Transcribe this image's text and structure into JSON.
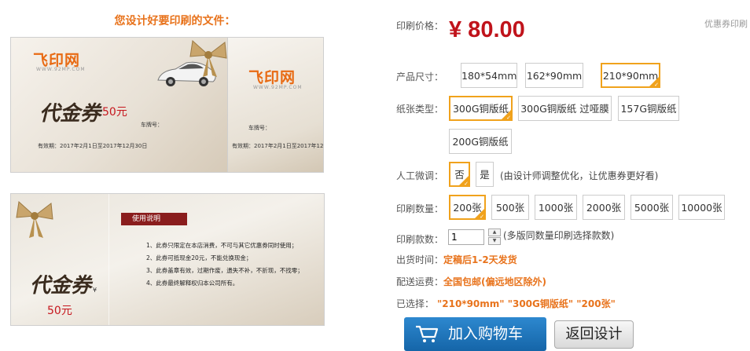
{
  "preview": {
    "title": "您设计好要印刷的文件：",
    "front": {
      "logo": "飞印网",
      "logo_sub": "WWW.92MP.COM",
      "voucher": "代金券",
      "amount": "50元",
      "plate_label": "车牌号：",
      "validity": "有效期：2017年2月1日至2017年12月30日"
    },
    "back_top": {
      "logo": "飞印网",
      "logo_sub": "WWW.92MP.COM",
      "plate_label": "车牌号：",
      "validity": "有效期：2017年2月1日至2017年12月30日"
    },
    "bottom": {
      "voucher": "代金券",
      "yen": "¥",
      "amount": "50元",
      "usage_title": "使用说明",
      "rules": [
        "1、此券只限定在本店消费，不可与其它优惠券同时使用；",
        "2、此券可抵现金20元，不能兑换现金；",
        "3、此券盖章有效，过期作废，遗失不补，不折现，不找零；",
        "4、此券最终解释权归本公司所有。"
      ]
    }
  },
  "product": {
    "price_label": "印刷价格：",
    "price": "¥ 80.00",
    "coupon": "优惠券印刷",
    "size_label": "产品尺寸：",
    "sizes": [
      "180*54mm",
      "162*90mm",
      "210*90mm"
    ],
    "paper_label": "纸张类型：",
    "papers": [
      "300G铜版纸",
      "300G铜版纸 过哑膜",
      "157G铜版纸",
      "200G铜版纸"
    ],
    "manual_label": "人工微调：",
    "manual_options": [
      "否",
      "是"
    ],
    "manual_hint": "(由设计师调整优化，让优惠券更好看)",
    "qty_label": "印刷数量：",
    "quantities": [
      "200张",
      "500张",
      "1000张",
      "2000张",
      "5000张",
      "10000张"
    ],
    "versions_label": "印刷款数：",
    "versions_value": "1",
    "versions_hint": "(多版同数量印刷选择款数)",
    "ship_time_label": "出货时间：",
    "ship_time": "定稿后1-2天发货",
    "shipping_label": "配送运费：",
    "shipping": "全国包邮(偏远地区除外)",
    "selected_label": "已选择：",
    "selected": "\"210*90mm\" \"300G铜版纸\" \"200张\"",
    "add_cart": "加入购物车",
    "back_design": "返回设计"
  },
  "colors": {
    "accent_orange": "#e8731c",
    "price_red": "#c0131b",
    "selected_border": "#f0a21c",
    "cart_blue": "#1f77bf"
  }
}
